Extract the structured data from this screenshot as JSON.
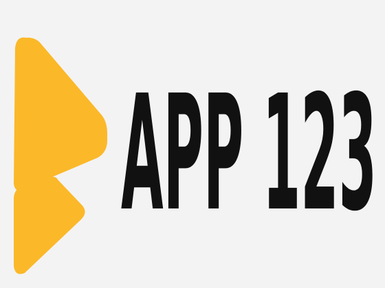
{
  "logo": {
    "wordmark_text": "APP 123",
    "mark_icon": "chevron-arrow-logo-icon",
    "colors": {
      "mark": "#fbb829",
      "text": "#111111",
      "background": "#f3f3f3"
    }
  }
}
